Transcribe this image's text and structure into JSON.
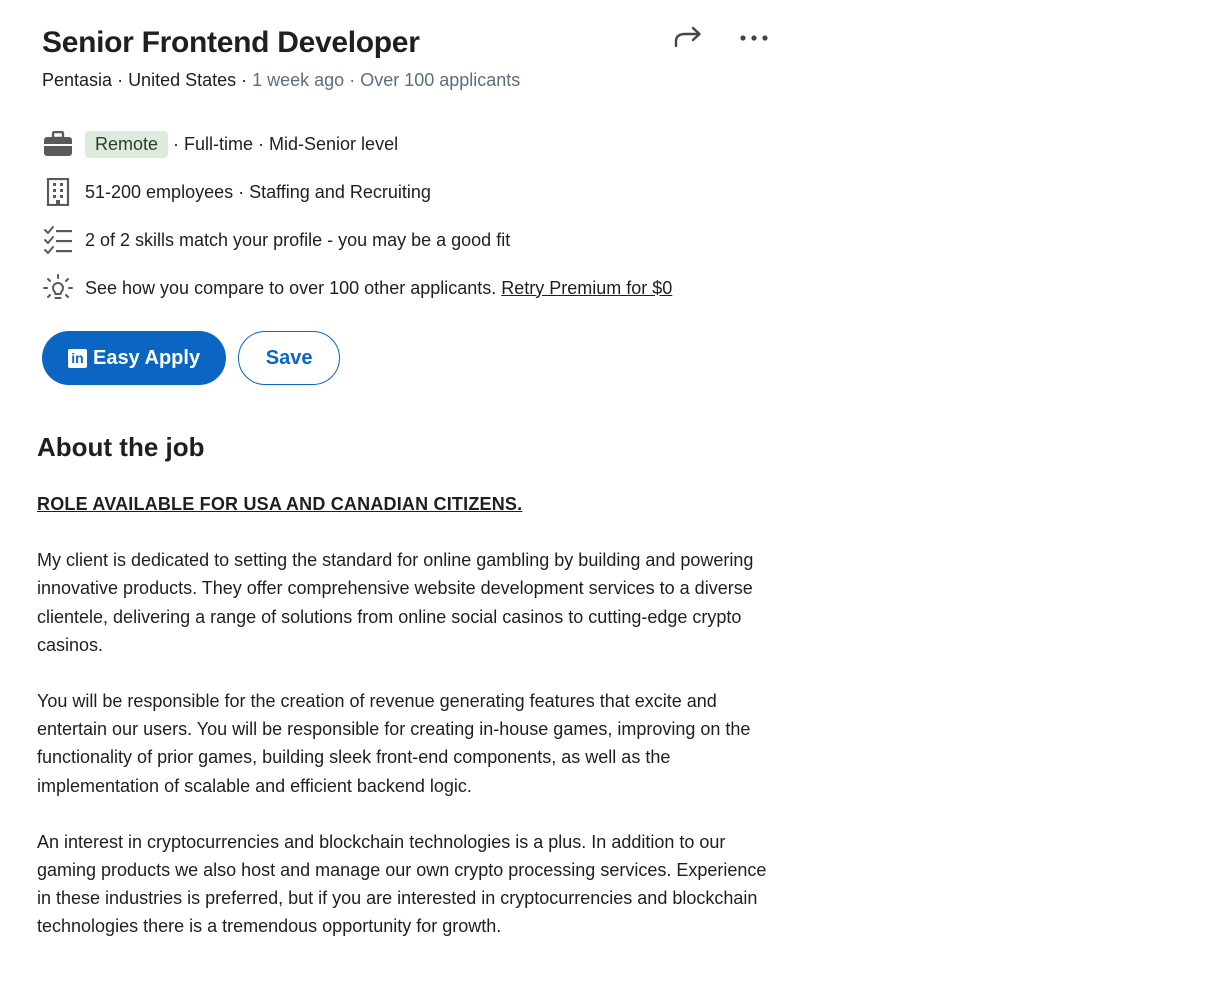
{
  "job": {
    "title": "Senior Frontend Developer",
    "company": "Pentasia",
    "location": "United States",
    "posted": "1 week ago",
    "applicants": "Over 100 applicants",
    "sep": " · "
  },
  "actions": {
    "share_icon": "share-arrow-icon",
    "more_icon": "more-dots-icon"
  },
  "insights": {
    "workplace_badge": "Remote",
    "job_type": "· Full-time · Mid-Senior level",
    "company_size": "51-200 employees · Staffing and Recruiting",
    "skills": "2 of 2 skills match your profile - you may be a good fit",
    "compare": "See how you compare to over 100 other applicants.",
    "premium_link": "Retry Premium for $0"
  },
  "buttons": {
    "easy_apply": "Easy Apply",
    "save": "Save",
    "linkedin_mark": "in"
  },
  "about": {
    "heading": "About the job",
    "caps_line": "ROLE AVAILABLE FOR USA AND CANADIAN CITIZENS.",
    "paragraphs": [
      "My client is dedicated to setting the standard for online gambling by building and powering innovative products. They offer comprehensive website development services to a diverse clientele, delivering a range of solutions from online social casinos to cutting-edge crypto casinos.",
      "You will be responsible for the creation of revenue generating features that excite and entertain our users. You will be responsible for creating in-house games, improving on the functionality of prior games, building sleek front-end components, as well as the implementation of scalable and efficient backend logic.",
      "An interest in cryptocurrencies and blockchain technologies is a plus. In addition to our gaming products we also host and manage our own crypto processing services. Experience in these industries is preferred, but if you are interested in cryptocurrencies and blockchain technologies there is a tremendous opportunity for growth."
    ]
  },
  "colors": {
    "brand": "#0a66c2",
    "badge_bg": "#dbecdb",
    "muted": "#5e6d7e"
  }
}
